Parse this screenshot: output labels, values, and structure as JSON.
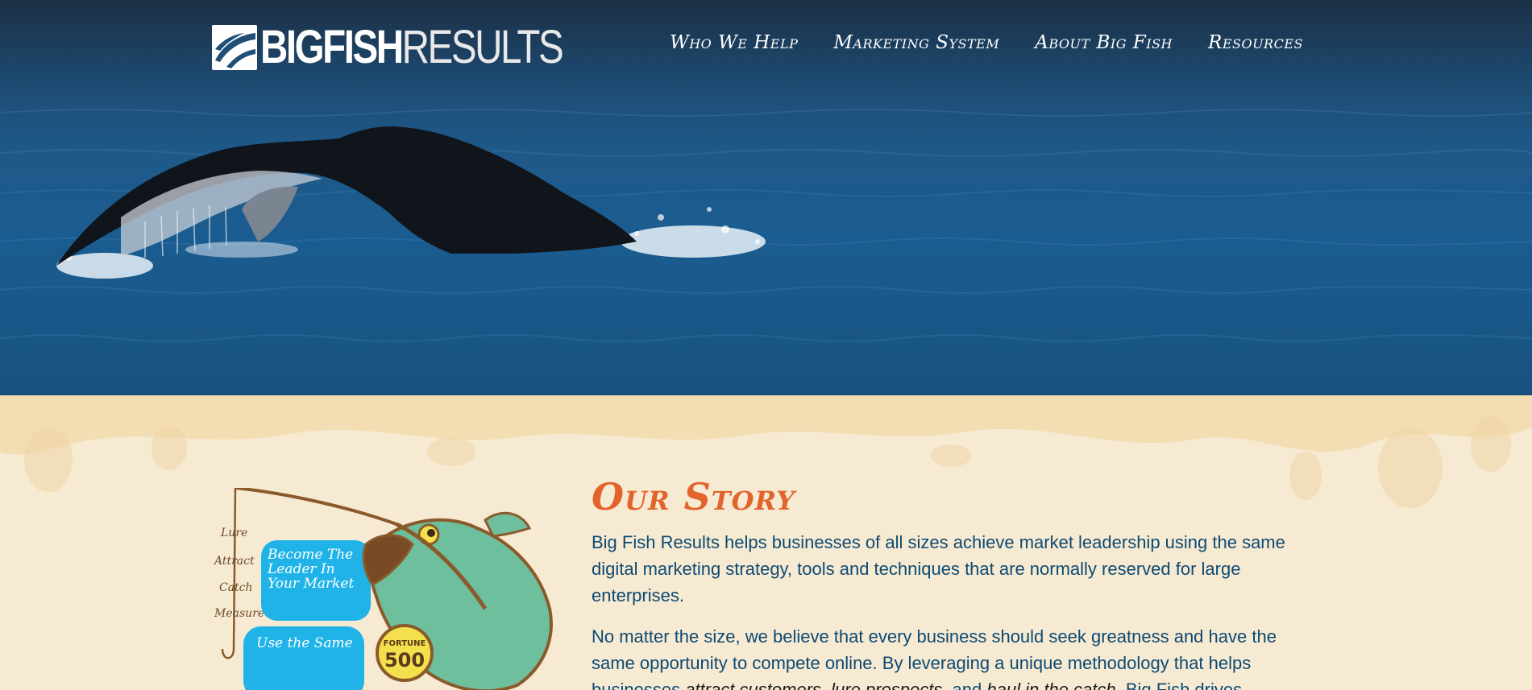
{
  "header": {
    "logo_text_bold": "BIGFISH",
    "logo_text_light": "RESULTS",
    "logo_icon": "fish-logo-icon"
  },
  "nav": {
    "items": [
      {
        "label": "Who We Help"
      },
      {
        "label": "Marketing System"
      },
      {
        "label": "About Big Fish"
      },
      {
        "label": "Resources"
      }
    ]
  },
  "story": {
    "title": "Our Story",
    "para1": "Big Fish Results helps businesses of all sizes achieve market leadership using the same digital marketing strategy, tools and techniques that are normally reserved for large enterprises.",
    "para2_start": "No matter the size, we believe that every business should seek greatness and have the same opportunity to compete online. By leveraging a unique methodology that helps businesses ",
    "para2_em1": "attract customers",
    "para2_sep1": ", ",
    "para2_em2": "lure prospects",
    "para2_sep2": ", and ",
    "para2_em3": "haul in the catch",
    "para2_end": ". Big Fish drives"
  },
  "illustration": {
    "steps": [
      "Lure",
      "Attract",
      "Catch",
      "Measure"
    ],
    "bubble1": "Become The Leader In Your Market",
    "bubble2": "Use the Same",
    "badge_top": "FORTUNE",
    "badge_num": "500"
  },
  "colors": {
    "accent": "#e2642c",
    "text_blue": "#0c4a73",
    "bubble_blue": "#1fb3e8",
    "fish_green": "#6dbf9e",
    "cream": "#f7ead2"
  }
}
